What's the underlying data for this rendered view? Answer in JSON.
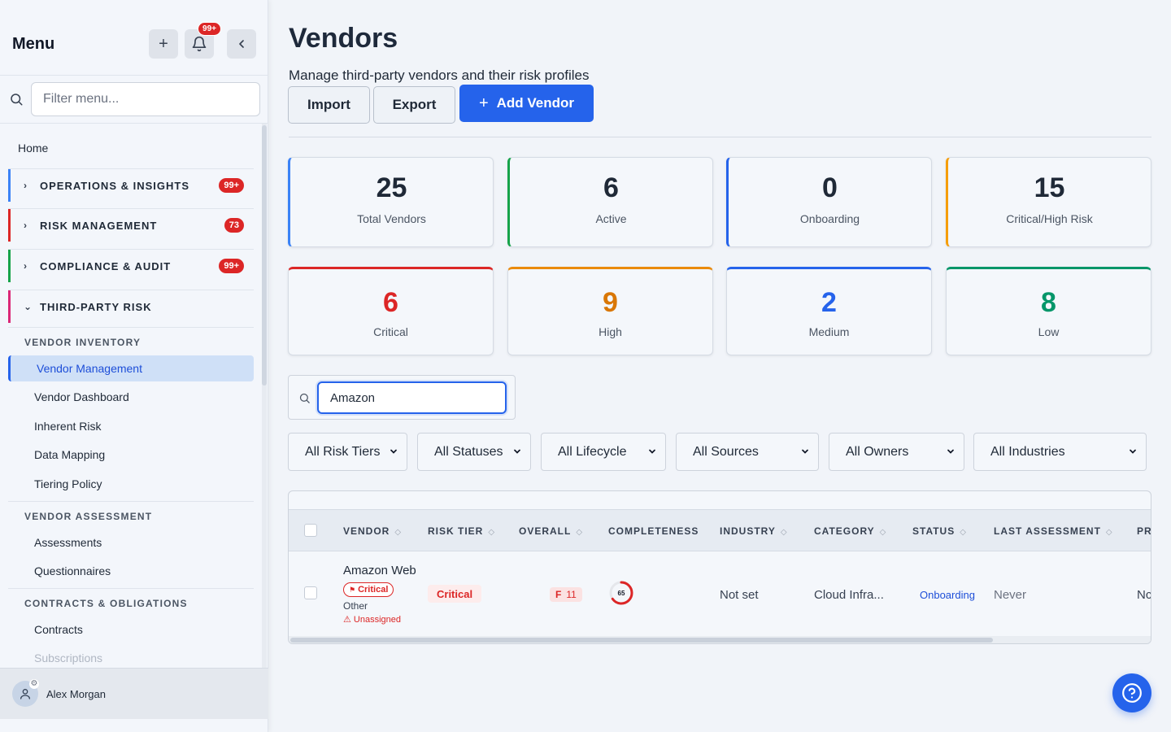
{
  "sidebar": {
    "title": "Menu",
    "notification_count": "99+",
    "filter_placeholder": "Filter menu...",
    "home": "Home",
    "sections": [
      {
        "label": "OPERATIONS & INSIGHTS",
        "count": "99+",
        "color": "#3b82f6",
        "expanded": false
      },
      {
        "label": "RISK MANAGEMENT",
        "count": "73",
        "color": "#dc2626",
        "expanded": false
      },
      {
        "label": "COMPLIANCE & AUDIT",
        "count": "99+",
        "color": "#16a34a",
        "expanded": false
      },
      {
        "label": "THIRD-PARTY RISK",
        "count": "",
        "color": "#db2777",
        "expanded": true
      }
    ],
    "groups": [
      {
        "label": "VENDOR INVENTORY",
        "items": [
          "Vendor Management",
          "Vendor Dashboard",
          "Inherent Risk",
          "Data Mapping",
          "Tiering Policy"
        ]
      },
      {
        "label": "VENDOR ASSESSMENT",
        "items": [
          "Assessments",
          "Questionnaires"
        ]
      },
      {
        "label": "CONTRACTS & OBLIGATIONS",
        "items": [
          "Contracts",
          "Subscriptions"
        ]
      }
    ],
    "active_item": "Vendor Management",
    "user": {
      "name": "Alex Morgan"
    }
  },
  "header": {
    "title": "Vendors",
    "subtitle": "Manage third-party vendors and their risk profiles",
    "buttons": {
      "import": "Import",
      "export": "Export",
      "add": "Add Vendor"
    }
  },
  "stats": [
    {
      "value": "25",
      "label": "Total Vendors",
      "accent": "#3b82f6",
      "value_color": "#1f2937"
    },
    {
      "value": "6",
      "label": "Active",
      "accent": "#16a34a",
      "value_color": "#1f2937"
    },
    {
      "value": "0",
      "label": "Onboarding",
      "accent": "#2563eb",
      "value_color": "#1f2937"
    },
    {
      "value": "15",
      "label": "Critical/High Risk",
      "accent": "#f59e0b",
      "value_color": "#1f2937"
    },
    {
      "value": "6",
      "label": "Critical",
      "accent": "#dc2626",
      "value_color": "#dc2626"
    },
    {
      "value": "9",
      "label": "High",
      "accent": "#ea8a0c",
      "value_color": "#d97706"
    },
    {
      "value": "2",
      "label": "Medium",
      "accent": "#2563eb",
      "value_color": "#2563eb"
    },
    {
      "value": "8",
      "label": "Low",
      "accent": "#059669",
      "value_color": "#059669"
    }
  ],
  "search": {
    "value": "Amazon"
  },
  "filters": [
    "All Risk Tiers",
    "All Statuses",
    "All Lifecycle",
    "All Sources",
    "All Owners",
    "All Industries"
  ],
  "table": {
    "columns": [
      "VENDOR",
      "RISK TIER",
      "OVERALL",
      "COMPLETENESS",
      "INDUSTRY",
      "CATEGORY",
      "STATUS",
      "LAST ASSESSMENT",
      "PR"
    ],
    "rows": [
      {
        "vendor": "Amazon Web",
        "criticality": "Critical",
        "category_line": "Other",
        "owner": "⚠ Unassigned",
        "risk_tier": "Critical",
        "overall_grade": "F",
        "overall_score": "11",
        "completeness": "65",
        "completeness_fraction": 0.65,
        "industry": "Not set",
        "category": "Cloud Infra...",
        "status": "Onboarding",
        "last_assessment": "Never",
        "pr": "Nc"
      }
    ]
  },
  "colors": {
    "primary": "#2563eb",
    "danger": "#dc2626"
  }
}
